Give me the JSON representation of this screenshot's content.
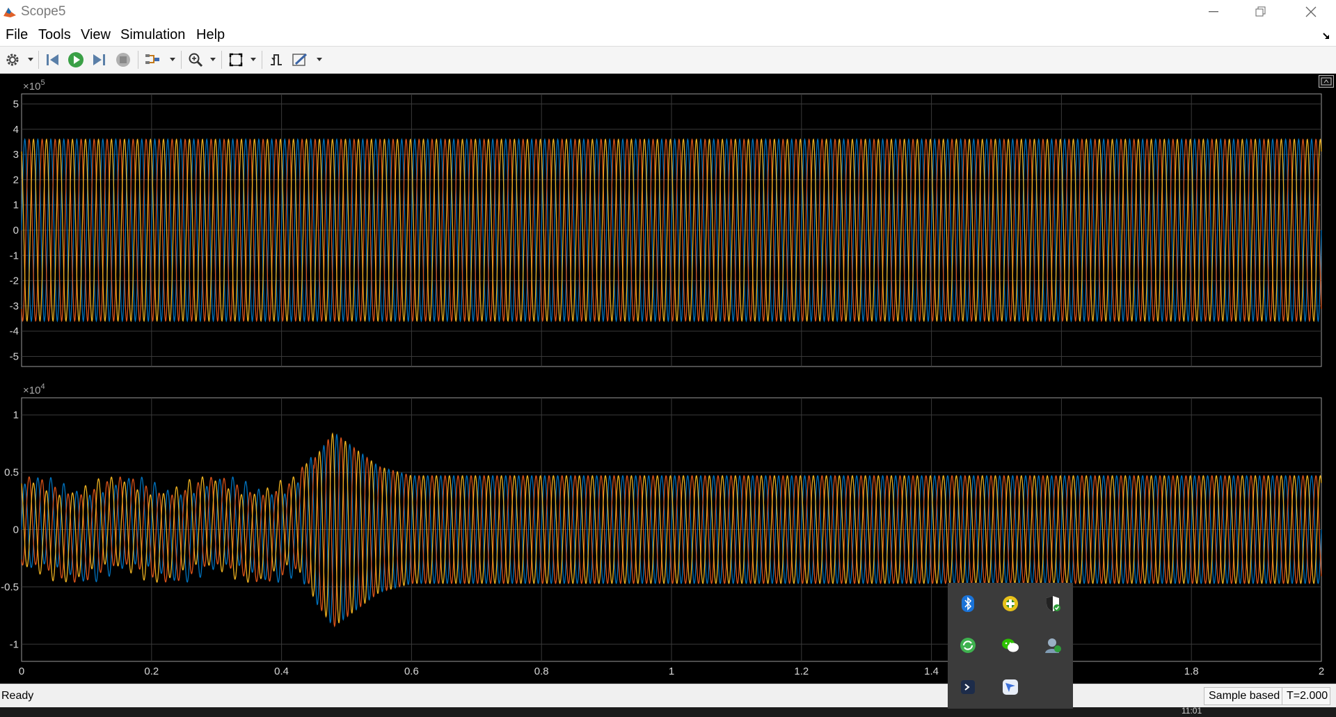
{
  "window": {
    "title": "Scope5"
  },
  "menu": [
    "File",
    "Tools",
    "View",
    "Simulation",
    "Help"
  ],
  "toolbar": {
    "buttons": [
      {
        "name": "configuration-properties-button",
        "icon": "gear-icon"
      },
      {
        "name": "step-back-button",
        "icon": "step-back-icon"
      },
      {
        "name": "run-button",
        "icon": "play-icon"
      },
      {
        "name": "step-forward-button",
        "icon": "step-forward-icon"
      },
      {
        "name": "stop-button",
        "icon": "stop-icon"
      },
      {
        "name": "signal-selection-button",
        "icon": "signal-select-icon"
      },
      {
        "name": "zoom-in-button",
        "icon": "zoom-in-icon"
      },
      {
        "name": "autoscale-button",
        "icon": "autoscale-icon"
      },
      {
        "name": "triggers-button",
        "icon": "trigger-icon"
      },
      {
        "name": "cursor-measurements-button",
        "icon": "measure-icon"
      }
    ]
  },
  "status": {
    "ready": "Ready",
    "mode": "Sample based",
    "time": "T=2.000"
  },
  "tray": {
    "clock_partial": "11:01"
  },
  "colors": {
    "background": "#000000",
    "grid": "#3a3a3a",
    "axis_text": "#d8d8d8",
    "series": [
      "#0072bd",
      "#d95319",
      "#edb120"
    ]
  },
  "chart_data": [
    {
      "type": "line",
      "multiplier_base": "×10",
      "multiplier_exp": "5",
      "xlim": [
        0,
        2
      ],
      "ylim": [
        -5.4,
        5.4
      ],
      "yticks": [
        "5",
        "4",
        "3",
        "2",
        "1",
        "0",
        "-1",
        "-2",
        "-3",
        "-4",
        "-5"
      ],
      "ytick_values": [
        5,
        4,
        3,
        2,
        1,
        0,
        -1,
        -2,
        -3,
        -4,
        -5
      ],
      "grid": true,
      "series": [
        {
          "amplitude": 3.6,
          "phase_deg": 0
        },
        {
          "amplitude": 3.6,
          "phase_deg": -120
        },
        {
          "amplitude": 3.6,
          "phase_deg": 120
        }
      ],
      "frequency_hz": 50
    },
    {
      "type": "line",
      "multiplier_base": "×10",
      "multiplier_exp": "4",
      "xlim": [
        0,
        2
      ],
      "ylim": [
        -1.15,
        1.15
      ],
      "yticks": [
        "1",
        "0.5",
        "0",
        "-0.5",
        "-1"
      ],
      "ytick_values": [
        1,
        0.5,
        0,
        -0.5,
        -1
      ],
      "xticks": [
        "0",
        "0.2",
        "0.4",
        "0.6",
        "0.8",
        "1",
        "1.2",
        "1.4",
        "1.6",
        "1.8",
        "2"
      ],
      "xtick_values": [
        0,
        0.2,
        0.4,
        0.6,
        0.8,
        1,
        1.2,
        1.4,
        1.6,
        1.8,
        2
      ],
      "grid": true,
      "envelope_t": [
        0,
        0.1,
        0.42,
        0.48,
        0.55,
        0.6,
        2
      ],
      "envelope_amp": [
        0.38,
        0.38,
        0.38,
        0.85,
        0.55,
        0.47,
        0.47
      ],
      "series": [
        {
          "phase_deg": 0
        },
        {
          "phase_deg": -120
        },
        {
          "phase_deg": 120
        }
      ],
      "frequency_hz": 50
    }
  ]
}
